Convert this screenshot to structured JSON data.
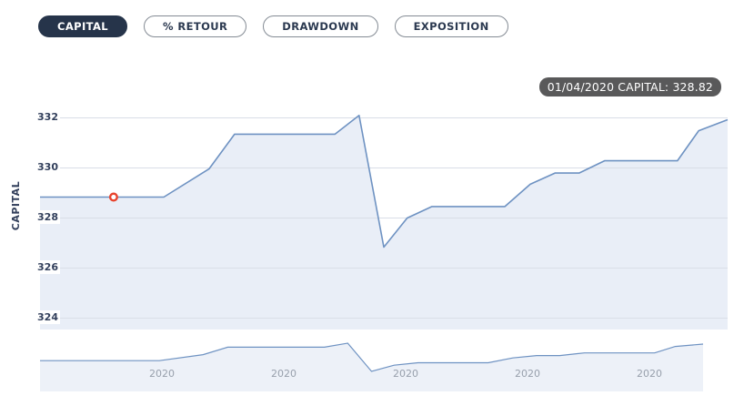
{
  "tabs": [
    {
      "label": "CAPITAL",
      "active": true
    },
    {
      "label": "% RETOUR",
      "active": false
    },
    {
      "label": "DRAWDOWN",
      "active": false
    },
    {
      "label": "EXPOSITION",
      "active": false
    }
  ],
  "tooltip": {
    "text": "01/04/2020 CAPITAL: 328.82"
  },
  "colors": {
    "accent_dark": "#26344a",
    "line": "#6e92c2",
    "area_fill": "#e9eef7",
    "nav_fill": "#edf1f8",
    "gridline": "#d9dee7",
    "marker": "#e8432d",
    "tick_text": "#33405c",
    "xlabel_text": "#98a0ac",
    "tooltip_bg": "#59595a"
  },
  "chart_data": {
    "type": "area",
    "title": "",
    "xlabel": "",
    "ylabel": "CAPITAL",
    "yticks": [
      324,
      326,
      328,
      330,
      332
    ],
    "ylim": [
      323.4,
      332.4
    ],
    "grid": true,
    "legend": false,
    "x_axis_labels": [
      "2020",
      "2020",
      "2020",
      "2020",
      "2020"
    ],
    "marker": {
      "x": 0.107,
      "value": 328.82,
      "date": "01/04/2020"
    },
    "series": [
      {
        "name": "CAPITAL",
        "points": [
          [
            0.0,
            328.82
          ],
          [
            0.18,
            328.82
          ],
          [
            0.246,
            329.95
          ],
          [
            0.283,
            331.33
          ],
          [
            0.429,
            331.33
          ],
          [
            0.464,
            332.08
          ],
          [
            0.5,
            326.82
          ],
          [
            0.534,
            327.98
          ],
          [
            0.57,
            328.44
          ],
          [
            0.676,
            328.44
          ],
          [
            0.713,
            329.33
          ],
          [
            0.749,
            329.78
          ],
          [
            0.784,
            329.78
          ],
          [
            0.821,
            330.27
          ],
          [
            0.927,
            330.27
          ],
          [
            0.958,
            331.47
          ],
          [
            1.0,
            331.91
          ]
        ]
      }
    ],
    "navigator": true
  }
}
